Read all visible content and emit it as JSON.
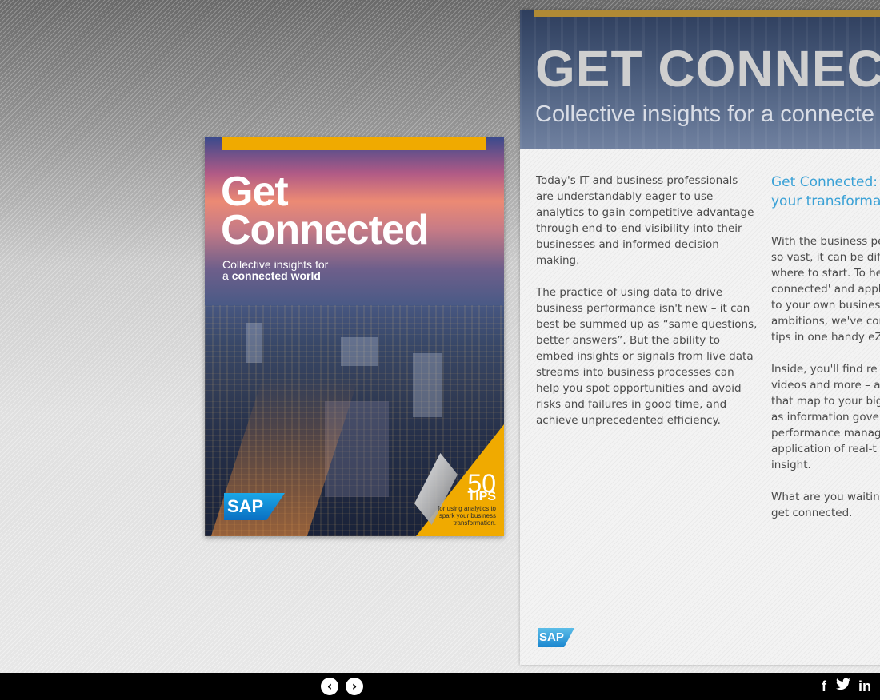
{
  "cover": {
    "title_line1": "Get",
    "title_line2": "Connected",
    "subtitle_line1": "Collective insights for",
    "subtitle_line2_prefix": "a",
    "subtitle_line2_bold": "connected world",
    "tips_number": "50",
    "tips_word": "TIPS",
    "tips_text": "for using analytics to spark your business transformation.",
    "logo_text": "SAP",
    "accent_color": "#f0aa00"
  },
  "page": {
    "title": "GET CONNECT",
    "subtitle": "Collective insights for a connecte",
    "accent_color": "#b08a35",
    "heading_color": "#3aa1d6",
    "col1_p1_lines": [
      "Today's IT and business professionals",
      "are understandably eager to use",
      "analytics to gain competitive advantage",
      "through end-to-end visibility into their",
      "businesses and informed decision",
      "making."
    ],
    "col1_p2_lines": [
      "The practice of using data to drive",
      "business performance isn't new – it can",
      "best be summed up as “same questions,",
      "better answers”. But the ability to",
      "embed insights or signals from live data",
      "streams into business processes can",
      "help you spot opportunities and avoid",
      "risks and failures in good time, and",
      "achieve unprecedented efficiency."
    ],
    "col2_heading_lines": [
      "Get Connected:",
      "your transforma"
    ],
    "col2_p1_lines": [
      "With the business pe",
      "so vast, it can be dif",
      "where to start. To he",
      "connected' and appl",
      "to your own busines",
      "ambitions, we've cor",
      "tips in one handy eZ"
    ],
    "col2_p2_lines": [
      "Inside, you'll find re",
      "videos and more – a",
      "that map to your big",
      "as information gove",
      "performance manag",
      "application of real-t",
      "insight."
    ],
    "col2_p3_lines": [
      "What are you waitin",
      "get connected."
    ],
    "logo_text": "SAP"
  },
  "nav": {
    "prev_icon": "‹",
    "next_icon": "›"
  },
  "social": {
    "facebook": "f",
    "twitter": "🐦",
    "linkedin": "in"
  }
}
